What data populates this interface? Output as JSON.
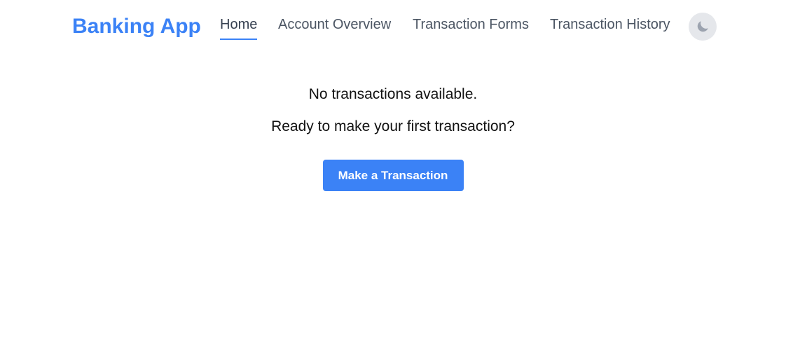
{
  "header": {
    "brand": "Banking App",
    "nav": [
      {
        "label": "Home",
        "active": true
      },
      {
        "label": "Account Overview",
        "active": false
      },
      {
        "label": "Transaction Forms",
        "active": false
      },
      {
        "label": "Transaction History",
        "active": false
      }
    ],
    "theme_toggle_icon": "moon-icon"
  },
  "main": {
    "empty_message": "No transactions available.",
    "prompt": "Ready to make your first transaction?",
    "cta_label": "Make a Transaction"
  },
  "colors": {
    "accent": "#3b82f6",
    "nav_text": "#4b5563",
    "toggle_bg": "#e5e7eb",
    "moon": "#9ca3af"
  }
}
